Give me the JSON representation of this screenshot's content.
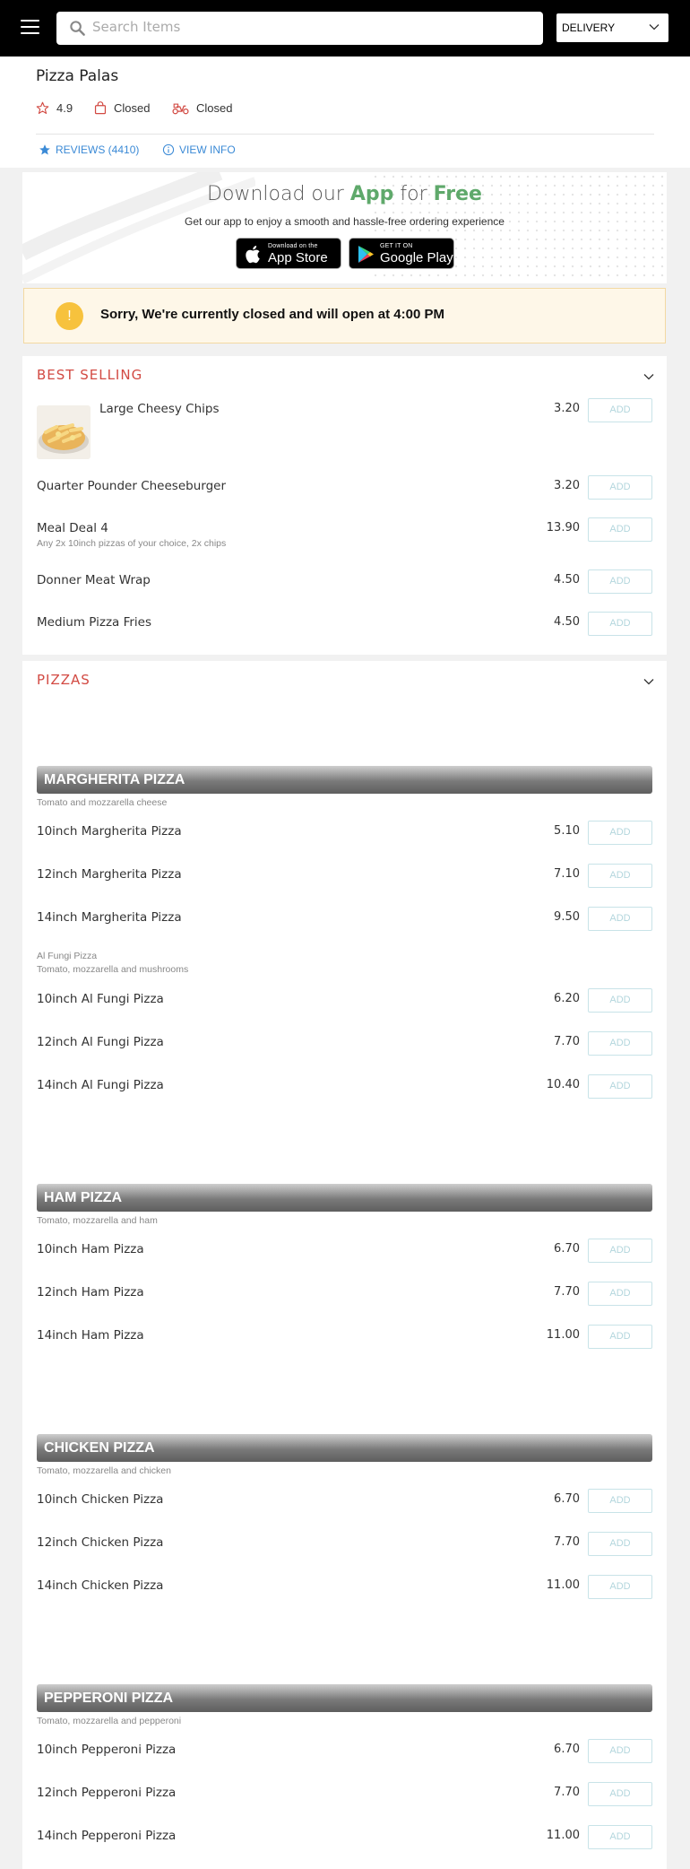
{
  "topbar": {
    "search_placeholder": "Search Items",
    "order_mode": "DELIVERY"
  },
  "restaurant": {
    "name": "Pizza Palas",
    "rating": "4.9",
    "collection_status": "Closed",
    "delivery_status": "Closed",
    "reviews_label": "REVIEWS (4410)",
    "view_info_label": "VIEW INFO"
  },
  "promo": {
    "title_pre": "Download our ",
    "title_app": "App",
    "title_mid": " for ",
    "title_free": "Free",
    "subtitle": "Get our app to enjoy a smooth and hassle-free ordering experience",
    "appstore_small": "Download on the",
    "appstore_big": "App Store",
    "googleplay_small": "GET IT ON",
    "googleplay_big": "Google Play"
  },
  "notice": {
    "icon": "!",
    "message": "Sorry, We're currently closed and will open at 4:00 PM"
  },
  "best_selling": {
    "title": "BEST SELLING",
    "items": [
      {
        "name": "Large Cheesy Chips",
        "price": "3.20",
        "add": "ADD"
      },
      {
        "name": "Quarter Pounder Cheeseburger",
        "price": "3.20",
        "add": "ADD"
      },
      {
        "name": "Meal Deal 4",
        "desc": "Any 2x 10inch pizzas of your choice, 2x chips",
        "price": "13.90",
        "add": "ADD"
      },
      {
        "name": "Donner Meat Wrap",
        "price": "4.50",
        "add": "ADD"
      },
      {
        "name": "Medium Pizza Fries",
        "price": "4.50",
        "add": "ADD"
      }
    ]
  },
  "pizzas": {
    "title": "PIZZAS",
    "margherita": {
      "title": "MARGHERITA PIZZA",
      "desc": "Tomato and mozzarella cheese",
      "items": [
        {
          "name": "10inch Margherita Pizza",
          "price": "5.10",
          "add": "ADD"
        },
        {
          "name": "12inch Margherita Pizza",
          "price": "7.10",
          "add": "ADD"
        },
        {
          "name": "14inch Margherita Pizza",
          "price": "9.50",
          "add": "ADD"
        }
      ],
      "sub_title": "Al Fungi Pizza",
      "sub_desc": "Tomato, mozzarella and mushrooms",
      "sub_items": [
        {
          "name": "10inch Al Fungi Pizza",
          "price": "6.20",
          "add": "ADD"
        },
        {
          "name": "12inch Al Fungi Pizza",
          "price": "7.70",
          "add": "ADD"
        },
        {
          "name": "14inch Al Fungi Pizza",
          "price": "10.40",
          "add": "ADD"
        }
      ]
    },
    "ham": {
      "title": "HAM PIZZA",
      "desc": "Tomato, mozzarella and ham",
      "items": [
        {
          "name": "10inch Ham Pizza",
          "price": "6.70",
          "add": "ADD"
        },
        {
          "name": "12inch Ham Pizza",
          "price": "7.70",
          "add": "ADD"
        },
        {
          "name": "14inch Ham Pizza",
          "price": "11.00",
          "add": "ADD"
        }
      ]
    },
    "chicken": {
      "title": "CHICKEN PIZZA",
      "desc": "Tomato, mozzarella and chicken",
      "items": [
        {
          "name": "10inch Chicken Pizza",
          "price": "6.70",
          "add": "ADD"
        },
        {
          "name": "12inch Chicken Pizza",
          "price": "7.70",
          "add": "ADD"
        },
        {
          "name": "14inch Chicken Pizza",
          "price": "11.00",
          "add": "ADD"
        }
      ]
    },
    "pepperoni": {
      "title": "PEPPERONI PIZZA",
      "desc": "Tomato, mozzarella and pepperoni",
      "items": [
        {
          "name": "10inch Pepperoni Pizza",
          "price": "6.70",
          "add": "ADD"
        },
        {
          "name": "12inch Pepperoni Pizza",
          "price": "7.70",
          "add": "ADD"
        },
        {
          "name": "14inch Pepperoni Pizza",
          "price": "11.00",
          "add": "ADD"
        }
      ]
    }
  },
  "colors": {
    "accent_red": "#d24a43",
    "link_blue": "#3b8ad6",
    "app_green": "#5fa96b",
    "notice_yellow": "#f7c23d"
  }
}
